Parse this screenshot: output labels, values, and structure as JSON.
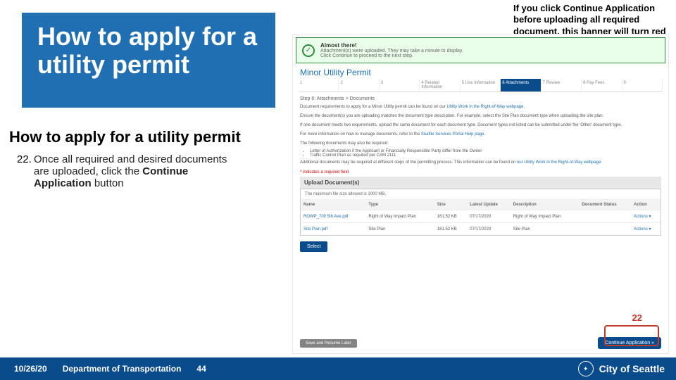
{
  "title": "How to apply for a utility permit",
  "subheading": "How to apply for a utility permit",
  "step": {
    "num": "22.",
    "text_before": "Once all required and desired documents are uploaded, click the ",
    "bold": "Continue Application",
    "text_after": " button"
  },
  "annotation": "If you click Continue Application before uploading all required document, this banner will turn red and indicate what documents are missing. It will turn green when all required documents have been uploaded.",
  "shot": {
    "banner_line1": "Almost there!",
    "banner_line2a": "Attachment(s) were uploaded. They may take a minute to display.",
    "banner_line2b": "Click Continue to proceed to the next step.",
    "permit_title": "Minor Utility Permit",
    "stepper": [
      "1",
      "2",
      "3",
      "4 Related Information",
      "5 Use Information",
      "6 Attachments",
      "7 Review",
      "8 Pay Fees",
      "9"
    ],
    "stepper_active_index": 5,
    "step_label": "Step 6: Attachments > Documents",
    "para1a": "Document requirements to apply for a Minor Utility permit can be found on our ",
    "para1_link": "Utility Work in the Right-of-Way webpage.",
    "para2": "Ensure the document(s) you are uploading matches the document type description. For example, select the Site Plan document type when uploading the site plan.",
    "para3": "If one document meets two requirements, upload the same document for each document type. Document types not listed can be submitted under the 'Other' document type.",
    "para4a": "For more information on how to manage documents, refer to the ",
    "para4_link": "Seattle Services Portal Help page.",
    "para5": "The following documents may also be required:",
    "bullets": [
      "Letter of Authorization if the Applicant or Financially Responsible Party differ from the Owner",
      "Traffic Control Plan as required per CAM 2111"
    ],
    "para6a": "Additional documents may be required at different steps of the permitting process. This information can be found on ",
    "para6_link": "our Utility Work in the Right-of-Way webpage.",
    "req": "* indicates a required field",
    "upload_head": "Upload Document(s)",
    "upload_note": "The maximum file size allowed is 1000 MB.",
    "cols": [
      "Name",
      "Type",
      "Size",
      "Latest Update",
      "Description",
      "Document Status",
      "Action"
    ],
    "rows": [
      {
        "name": "ROWP_700 5th Ave.pdf",
        "type": "Right of Way Impact Plan",
        "size": "161.52 KB",
        "date": "07/17/2020",
        "desc": "Right of Way Impact Plan",
        "status": "",
        "action": "Actions ▾"
      },
      {
        "name": "Site Plan.pdf",
        "type": "Site Plan",
        "size": "161.52 KB",
        "date": "07/17/2020",
        "desc": "Site Plan",
        "status": "",
        "action": "Actions ▾"
      }
    ],
    "select": "Select",
    "save_resume": "Save and Resume Later",
    "continue": "Continue Application »"
  },
  "callout_num": "22",
  "footer": {
    "date": "10/26/20",
    "dept": "Department of Transportation",
    "page": "44",
    "brand1": "City of",
    "brand2": "City of Seattle"
  }
}
